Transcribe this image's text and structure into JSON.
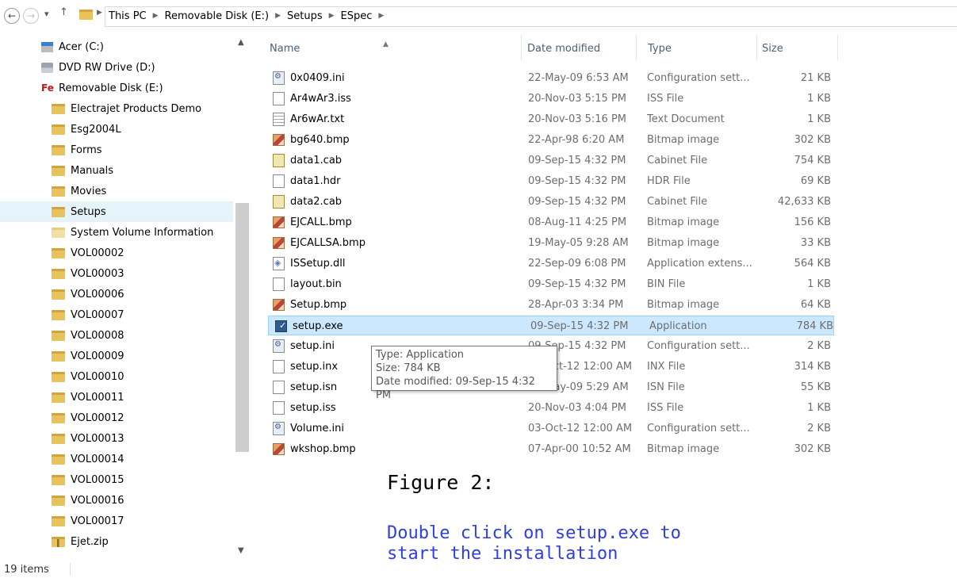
{
  "address_bar": {
    "crumbs": [
      "This PC",
      "Removable Disk (E:)",
      "Setups",
      "ESpec"
    ]
  },
  "nav_pane": {
    "items": [
      {
        "label": "Acer (C:)",
        "icon": "drive-icon",
        "indent": 0
      },
      {
        "label": "DVD RW Drive (D:)",
        "icon": "dvd-drive-icon",
        "indent": 0
      },
      {
        "label": "Removable Disk (E:)",
        "icon": "removable-disk-icon",
        "indent": 0
      },
      {
        "label": "Electrajet Products Demo",
        "icon": "folder-icon",
        "indent": 1
      },
      {
        "label": "Esg2004L",
        "icon": "folder-icon",
        "indent": 1
      },
      {
        "label": "Forms",
        "icon": "folder-icon",
        "indent": 1
      },
      {
        "label": "Manuals",
        "icon": "folder-icon",
        "indent": 1
      },
      {
        "label": "Movies",
        "icon": "folder-icon",
        "indent": 1
      },
      {
        "label": "Setups",
        "icon": "folder-icon",
        "indent": 1,
        "selected": true
      },
      {
        "label": "System Volume Information",
        "icon": "folder-icon",
        "indent": 1
      },
      {
        "label": "VOL00002",
        "icon": "folder-icon",
        "indent": 1
      },
      {
        "label": "VOL00003",
        "icon": "folder-icon",
        "indent": 1
      },
      {
        "label": "VOL00006",
        "icon": "folder-icon",
        "indent": 1
      },
      {
        "label": "VOL00007",
        "icon": "folder-icon",
        "indent": 1
      },
      {
        "label": "VOL00008",
        "icon": "folder-icon",
        "indent": 1
      },
      {
        "label": "VOL00009",
        "icon": "folder-icon",
        "indent": 1
      },
      {
        "label": "VOL00010",
        "icon": "folder-icon",
        "indent": 1
      },
      {
        "label": "VOL00011",
        "icon": "folder-icon",
        "indent": 1
      },
      {
        "label": "VOL00012",
        "icon": "folder-icon",
        "indent": 1
      },
      {
        "label": "VOL00013",
        "icon": "folder-icon",
        "indent": 1
      },
      {
        "label": "VOL00014",
        "icon": "folder-icon",
        "indent": 1
      },
      {
        "label": "VOL00015",
        "icon": "folder-icon",
        "indent": 1
      },
      {
        "label": "VOL00016",
        "icon": "folder-icon",
        "indent": 1
      },
      {
        "label": "VOL00017",
        "icon": "folder-icon",
        "indent": 1
      },
      {
        "label": "Ejet.zip",
        "icon": "zip-folder-icon",
        "indent": 1
      }
    ]
  },
  "columns": {
    "name": "Name",
    "date": "Date modified",
    "type": "Type",
    "size": "Size"
  },
  "files": [
    {
      "name": "0x0409.ini",
      "date": "22-May-09 6:53 AM",
      "type": "Configuration sett...",
      "size": "21 KB",
      "icon": "ini"
    },
    {
      "name": "Ar4wAr3.iss",
      "date": "20-Nov-03 5:15 PM",
      "type": "ISS File",
      "size": "1 KB",
      "icon": "doc"
    },
    {
      "name": "Ar6wAr.txt",
      "date": "20-Nov-03 5:16 PM",
      "type": "Text Document",
      "size": "1 KB",
      "icon": "txt"
    },
    {
      "name": "bg640.bmp",
      "date": "22-Apr-98 6:20 AM",
      "type": "Bitmap image",
      "size": "302 KB",
      "icon": "bmp"
    },
    {
      "name": "data1.cab",
      "date": "09-Sep-15 4:32 PM",
      "type": "Cabinet File",
      "size": "754 KB",
      "icon": "cab"
    },
    {
      "name": "data1.hdr",
      "date": "09-Sep-15 4:32 PM",
      "type": "HDR File",
      "size": "69 KB",
      "icon": "doc"
    },
    {
      "name": "data2.cab",
      "date": "09-Sep-15 4:32 PM",
      "type": "Cabinet File",
      "size": "42,633 KB",
      "icon": "cab"
    },
    {
      "name": "EJCALL.bmp",
      "date": "08-Aug-11 4:25 PM",
      "type": "Bitmap image",
      "size": "156 KB",
      "icon": "bmp"
    },
    {
      "name": "EJCALLSA.bmp",
      "date": "19-May-05 9:28 AM",
      "type": "Bitmap image",
      "size": "33 KB",
      "icon": "bmp"
    },
    {
      "name": "ISSetup.dll",
      "date": "22-Sep-09 6:08 PM",
      "type": "Application extens...",
      "size": "564 KB",
      "icon": "dll"
    },
    {
      "name": "layout.bin",
      "date": "09-Sep-15 4:32 PM",
      "type": "BIN File",
      "size": "1 KB",
      "icon": "doc"
    },
    {
      "name": "Setup.bmp",
      "date": "28-Apr-03 3:34 PM",
      "type": "Bitmap image",
      "size": "64 KB",
      "icon": "bmp"
    },
    {
      "name": "setup.exe",
      "date": "09-Sep-15 4:32 PM",
      "type": "Application",
      "size": "784 KB",
      "icon": "exe",
      "selected": true
    },
    {
      "name": "setup.ini",
      "date": "09-Sep-15 4:32 PM",
      "type": "Configuration sett...",
      "size": "2 KB",
      "icon": "ini"
    },
    {
      "name": "setup.inx",
      "date": "03-Oct-12 12:00 AM",
      "type": "INX File",
      "size": "314 KB",
      "icon": "doc"
    },
    {
      "name": "setup.isn",
      "date": "22-May-09 5:29 AM",
      "type": "ISN File",
      "size": "55 KB",
      "icon": "doc"
    },
    {
      "name": "setup.iss",
      "date": "20-Nov-03 4:04 PM",
      "type": "ISS File",
      "size": "1 KB",
      "icon": "doc"
    },
    {
      "name": "Volume.ini",
      "date": "03-Oct-12 12:00 AM",
      "type": "Configuration sett...",
      "size": "2 KB",
      "icon": "ini"
    },
    {
      "name": "wkshop.bmp",
      "date": "07-Apr-00 10:52 AM",
      "type": "Bitmap image",
      "size": "302 KB",
      "icon": "bmp"
    }
  ],
  "tooltip": {
    "type_line": "Type: Application",
    "size_line": "Size: 784 KB",
    "date_line": "Date modified: 09-Sep-15 4:32 PM"
  },
  "annotation": {
    "figure_label": "Figure 2:",
    "instruction_line1": "Double click on setup.exe to",
    "instruction_line2": "start the installation"
  },
  "status_bar": {
    "item_count": "19 items"
  }
}
